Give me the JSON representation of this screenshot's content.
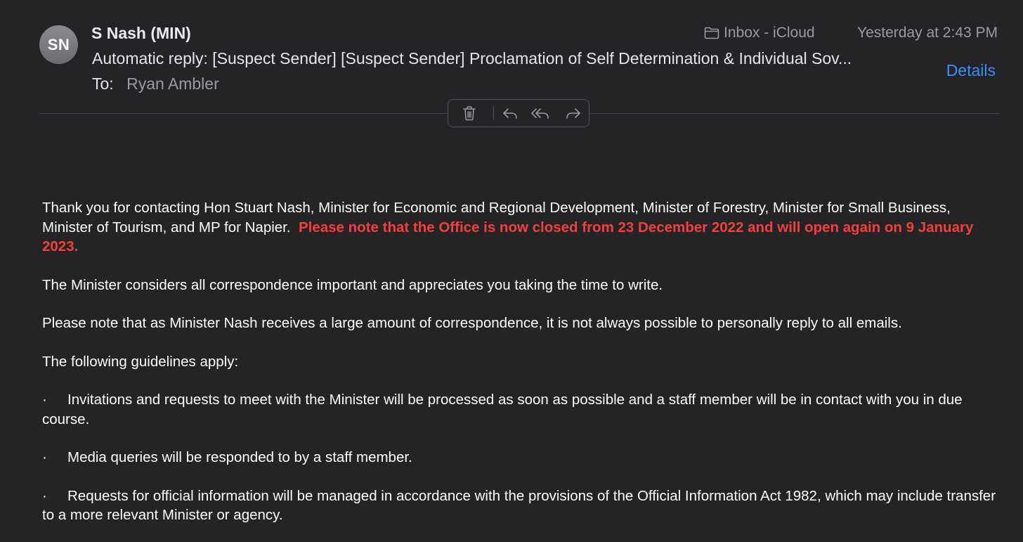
{
  "header": {
    "avatar_initials": "SN",
    "sender": "S Nash (MIN)",
    "subject": "Automatic reply: [Suspect Sender] [Suspect Sender] Proclamation of Self Determination & Individual Sov...",
    "to_label": "To:",
    "to_value": "Ryan Ambler",
    "mailbox": "Inbox - iCloud",
    "timestamp": "Yesterday at 2:43 PM",
    "details_label": "Details"
  },
  "toolbar": {
    "icons": [
      "trash-icon",
      "reply-icon",
      "reply-all-icon",
      "forward-icon"
    ]
  },
  "body": {
    "intro": "Thank you for contacting Hon Stuart Nash, Minister for Economic and Regional Development, Minister of Forestry, Minister for Small Business, Minister of Tourism, and MP for Napier.",
    "notice": "Please note that the Office is now closed from 23 December 2022 and will open again on 9 January 2023.",
    "p2": "The Minister considers all correspondence important and appreciates you taking the time to write.",
    "p3": "Please note that as Minister Nash receives a large amount of correspondence, it is not always possible to personally reply to all emails.",
    "p4": "The following guidelines apply:",
    "bullet_char": "·",
    "bullets": [
      "Invitations and requests to meet with the Minister will be processed as soon as possible and a staff member will be in contact with you in due course.",
      "Media queries will be responded to by a staff member.",
      "Requests for official information will be managed in accordance with the provisions of the Official Information Act 1982, which may include transfer to a more relevant Minister or agency."
    ]
  },
  "colors": {
    "background": "#252326",
    "accent_link": "#3d8ff5",
    "notice_red": "#f04040",
    "muted_text": "#9c9aa0"
  }
}
